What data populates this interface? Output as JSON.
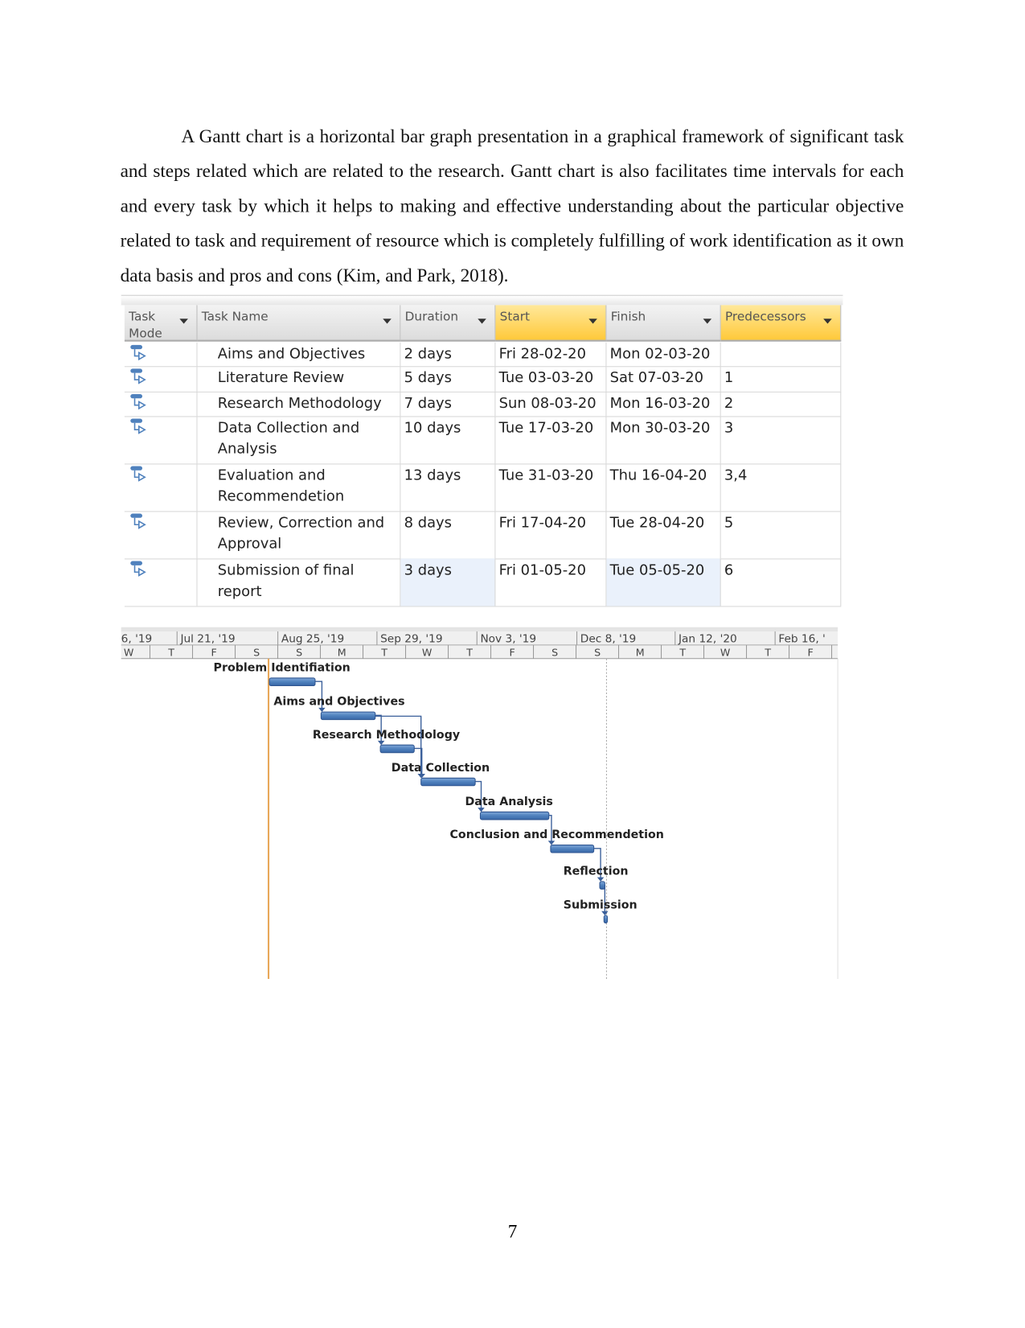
{
  "paragraph": "A Gantt chart is a horizontal bar graph presentation in a graphical framework of significant task and steps related which are related to the research. Gantt chart is also facilitates time intervals for each and every task by which it helps to making and effective understanding about the particular objective related to task and requirement of resource which is completely fulfilling of work identification as it own data basis and pros and cons (Kim, and Park, 2018).",
  "table": {
    "headers": [
      "Task Mode",
      "Task Name",
      "Duration",
      "Start",
      "Finish",
      "Predecessors"
    ],
    "highlight_color": "#ffc93a",
    "task_mode_icon": "auto-scheduled-task-icon",
    "rows": [
      {
        "name": "Aims and Objectives",
        "duration": "2 days",
        "start": "Fri 28-02-20",
        "finish": "Mon 02-03-20",
        "pred": ""
      },
      {
        "name": "Literature Review",
        "duration": "5 days",
        "start": "Tue 03-03-20",
        "finish": "Sat 07-03-20",
        "pred": "1"
      },
      {
        "name": "Research Methodology",
        "duration": "7 days",
        "start": "Sun 08-03-20",
        "finish": "Mon 16-03-20",
        "pred": "2"
      },
      {
        "name": "Data Collection and Analysis",
        "duration": "10 days",
        "start": "Tue 17-03-20",
        "finish": "Mon 30-03-20",
        "pred": "3"
      },
      {
        "name": "Evaluation and Recommendetion",
        "duration": "13 days",
        "start": "Tue 31-03-20",
        "finish": "Thu 16-04-20",
        "pred": "3,4"
      },
      {
        "name": "Review, Correction and Approval",
        "duration": "8 days",
        "start": "Fri 17-04-20",
        "finish": "Tue 28-04-20",
        "pred": "5"
      },
      {
        "name": "Submission of final report",
        "duration": "3 days",
        "start": "Fri 01-05-20",
        "finish": "Tue 05-05-20",
        "pred": "6"
      }
    ]
  },
  "gantt": {
    "bar_color": "#4f81bd",
    "today_line_color": "#e8a85a",
    "top_scale": [
      "6, '19",
      "Jul 21, '19",
      "Aug 25, '19",
      "Sep 29, '19",
      "Nov 3, '19",
      "Dec 8, '19",
      "Jan 12, '20",
      "Feb 16, '"
    ],
    "bottom_scale": [
      "W",
      "T",
      "F",
      "S",
      "S",
      "M",
      "T",
      "W",
      "T",
      "F",
      "S",
      "S",
      "M",
      "T",
      "W",
      "T",
      "F"
    ],
    "tasks": [
      "Problem Identifiation",
      "Aims and Objectives",
      "Research Methodology",
      "Data Collection",
      "Data Analysis",
      "Conclusion and Recommendetion",
      "Reflection",
      "Submission"
    ]
  },
  "page_number": "7"
}
